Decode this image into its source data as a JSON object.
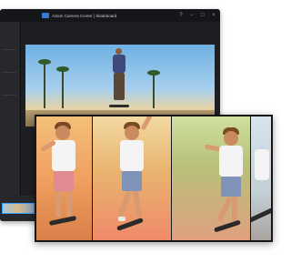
{
  "window": {
    "title": "Action Camera Center | Skateboard",
    "controls": {
      "help": "?",
      "minimize": "−",
      "maximize": "□",
      "close": "×"
    }
  },
  "colors": {
    "accent": "#3aa0ff",
    "window_bg": "#1e1f22",
    "titlebar_bg": "#15161a"
  },
  "icons": {
    "app_logo": "app-logo-icon",
    "help": "help-icon",
    "minimize": "minimize-icon",
    "maximize": "maximize-icon",
    "close": "close-icon",
    "play": "play-icon"
  }
}
